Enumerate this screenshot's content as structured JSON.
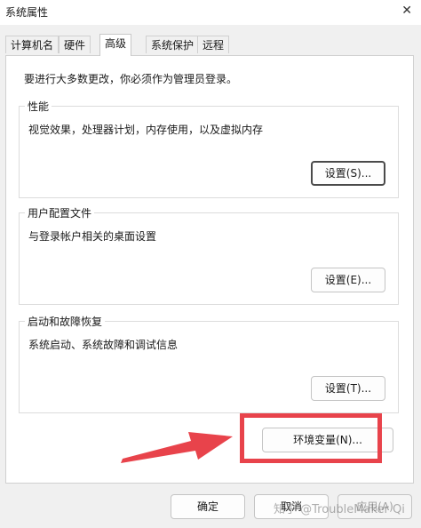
{
  "window": {
    "title": "系统属性",
    "close_glyph": "✕"
  },
  "tabs": [
    {
      "label": "计算机名"
    },
    {
      "label": "硬件"
    },
    {
      "label": "高级"
    },
    {
      "label": "系统保护"
    },
    {
      "label": "远程"
    }
  ],
  "active_tab": "高级",
  "panel": {
    "note": "要进行大多数更改，你必须作为管理员登录。",
    "performance": {
      "title": "性能",
      "description": "视觉效果，处理器计划，内存使用，以及虚拟内存",
      "button": "设置(S)..."
    },
    "user_profiles": {
      "title": "用户配置文件",
      "description": "与登录帐户相关的桌面设置",
      "button": "设置(E)..."
    },
    "startup_recovery": {
      "title": "启动和故障恢复",
      "description": "系统启动、系统故障和调试信息",
      "button": "设置(T)..."
    },
    "env_button": "环境变量(N)..."
  },
  "footer": {
    "ok": "确定",
    "cancel": "取消",
    "apply": "应用(A)"
  },
  "annotation": {
    "highlight_color": "#e8434b"
  },
  "watermark": "知乎 @TroubleMaker Qi"
}
